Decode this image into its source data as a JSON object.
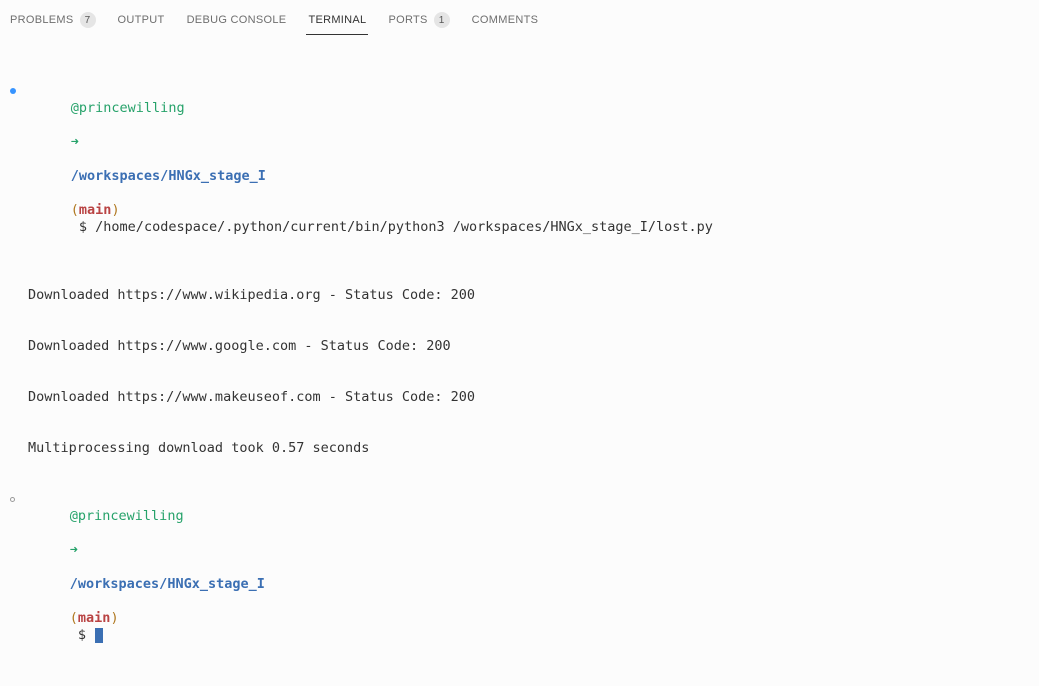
{
  "tabs": {
    "problems": {
      "label": "PROBLEMS",
      "badge": "7"
    },
    "output": {
      "label": "OUTPUT"
    },
    "debug": {
      "label": "DEBUG CONSOLE"
    },
    "terminal": {
      "label": "TERMINAL"
    },
    "ports": {
      "label": "PORTS",
      "badge": "1"
    },
    "comments": {
      "label": "COMMENTS"
    }
  },
  "prompt1": {
    "user": "@princewilling",
    "arrow": "➜",
    "path": "/workspaces/HNGx_stage_I",
    "lp": "(",
    "branch": "main",
    "rp": ")",
    "dollar": " $ ",
    "cmd": "/home/codespace/.python/current/bin/python3 /workspaces/HNGx_stage_I/lost.py"
  },
  "out": {
    "l1": "Downloaded https://www.wikipedia.org - Status Code: 200",
    "l2": "Downloaded https://www.google.com - Status Code: 200",
    "l3": "Downloaded https://www.makeuseof.com - Status Code: 200",
    "l4": "Multiprocessing download took 0.57 seconds"
  },
  "prompt2": {
    "user": "@princewilling",
    "arrow": "➜",
    "path": "/workspaces/HNGx_stage_I",
    "lp": "(",
    "branch": "main",
    "rp": ")",
    "dollar": " $ "
  }
}
